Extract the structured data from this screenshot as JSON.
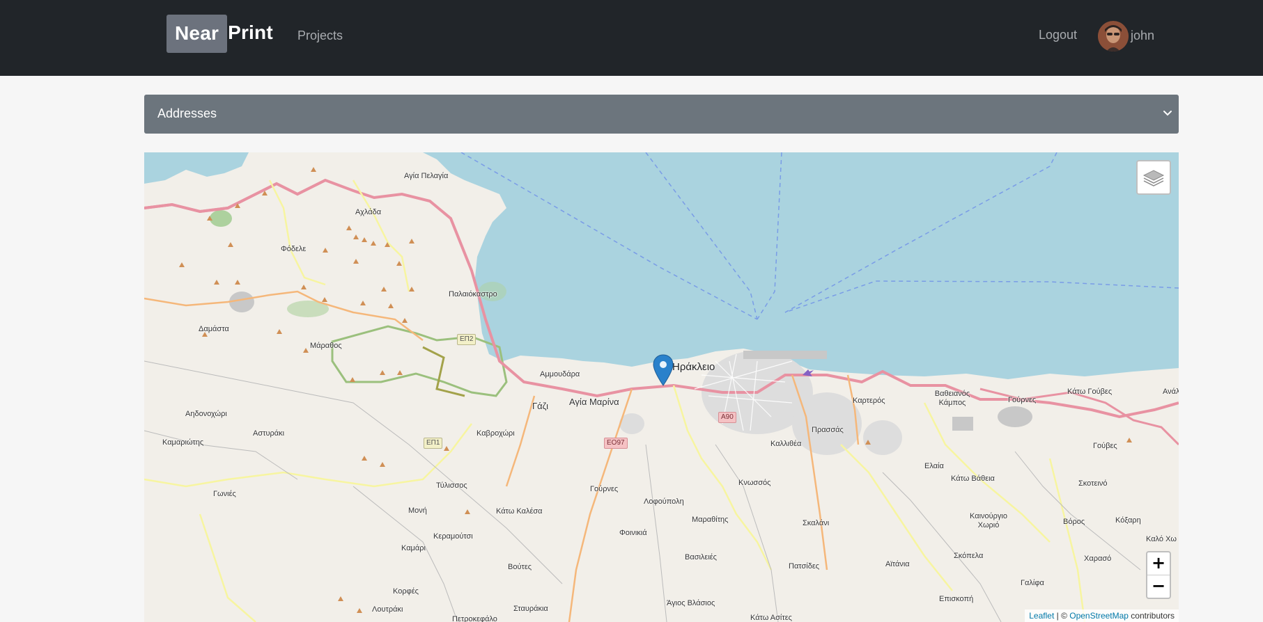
{
  "navbar": {
    "brand_first": "Near",
    "brand_second": "Print",
    "projects_label": "Projects",
    "logout_label": "Logout",
    "user_name": "john"
  },
  "address_select": {
    "selected": "Addresses"
  },
  "map": {
    "labels": [
      "Αγία Πελαγία",
      "Αχλάδα",
      "Φόδελε",
      "Παλαιόκαστρο",
      "Δαμάστα",
      "Μάραθος",
      "Αμμουδάρα",
      "Γάζι",
      "Αγία Μαρίνα",
      "Ηράκλειο",
      "Καρτερός",
      "Βαθειανός Κάμπος",
      "Γούρνες",
      "Κάτω Γούβες",
      "Ανάλ",
      "Αηδονοχώρι",
      "Καμαριώτης",
      "Αστυράκι",
      "Καβροχώρι",
      "Τύλισσος",
      "Γωνιές",
      "Μονή",
      "Κάτω Καλέσα",
      "Κεραμούτσι",
      "Καμάρι",
      "Βούτες",
      "Κορφές",
      "Λουτράκι",
      "Σταυράκια",
      "Πετροκεφάλο",
      "Γούρνες",
      "Λοφούπολη",
      "Φοινικιά",
      "Μαραθίτης",
      "Βασιλειές",
      "Άγιος Βλάσιος",
      "Κάτω Ασίτες",
      "Κνωσσός",
      "Καλλιθέα",
      "Πρασσάς",
      "Σκαλάνι",
      "Πατσίδες",
      "Αϊτάνια",
      "Επισκοπή",
      "Ελαία",
      "Κάτω Βάθεια",
      "Καινούργιο Χωριό",
      "Σκόπελα",
      "Γαλίφα",
      "Χαρασό",
      "Βόρος",
      "Κόξαρη",
      "Σκοτεινό",
      "Γούβες",
      "Καλό Χω"
    ],
    "road_shields": [
      "ΕΠ2",
      "ΕΠ1",
      "ΕΟ97",
      "Α90"
    ],
    "zoom_in": "+",
    "zoom_out": "−",
    "attribution_leaflet": "Leaflet",
    "attribution_sep": " | © ",
    "attribution_osm": "OpenStreetMap",
    "attribution_tail": " contributors",
    "colors": {
      "sea": "#aad3df",
      "land": "#f2efe9",
      "motorway": "#e892a2",
      "primary": "#fcd6a4",
      "marker": "#2a81cb"
    }
  }
}
